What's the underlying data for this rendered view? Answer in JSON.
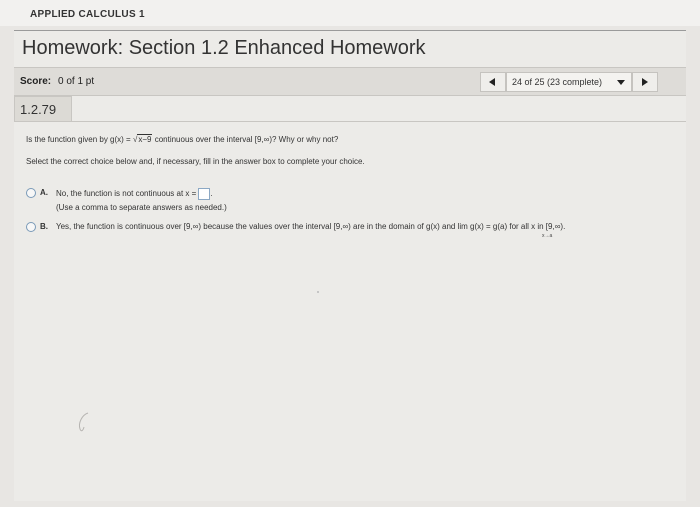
{
  "course": {
    "title": "APPLIED CALCULUS 1"
  },
  "homework": {
    "title": "Homework: Section 1.2 Enhanced Homework",
    "score_label": "Score:",
    "score_value": "0 of 1 pt",
    "nav_position": "24 of 25 (23 complete)"
  },
  "question": {
    "id": "1.2.79",
    "prompt_start": "Is the function given by g(x) = ",
    "prompt_radical": "x−9",
    "prompt_sqrt_sign": "√",
    "prompt_end": " continuous over the interval [9,∞)? Why or why not?",
    "instruction": "Select the correct choice below and, if necessary, fill in the answer box to complete your choice.",
    "choices": [
      {
        "letter": "A.",
        "text": "No, the function is not continuous at x =",
        "note": "(Use a comma to separate answers as needed.)"
      },
      {
        "letter": "B.",
        "text": "Yes, the function is continuous over [9,∞) because the values over the interval [9,∞) are in the domain of g(x) and  lim g(x) = g(a) for all x in [9,∞).",
        "lim_sub": "x→a"
      }
    ]
  },
  "colors": {
    "radio_border": "#7a9ab8",
    "page_bg": "#e8e6e3"
  },
  "icons": {
    "prev": "triangle-left-icon",
    "next": "triangle-right-icon",
    "dropdown": "caret-down-icon"
  }
}
